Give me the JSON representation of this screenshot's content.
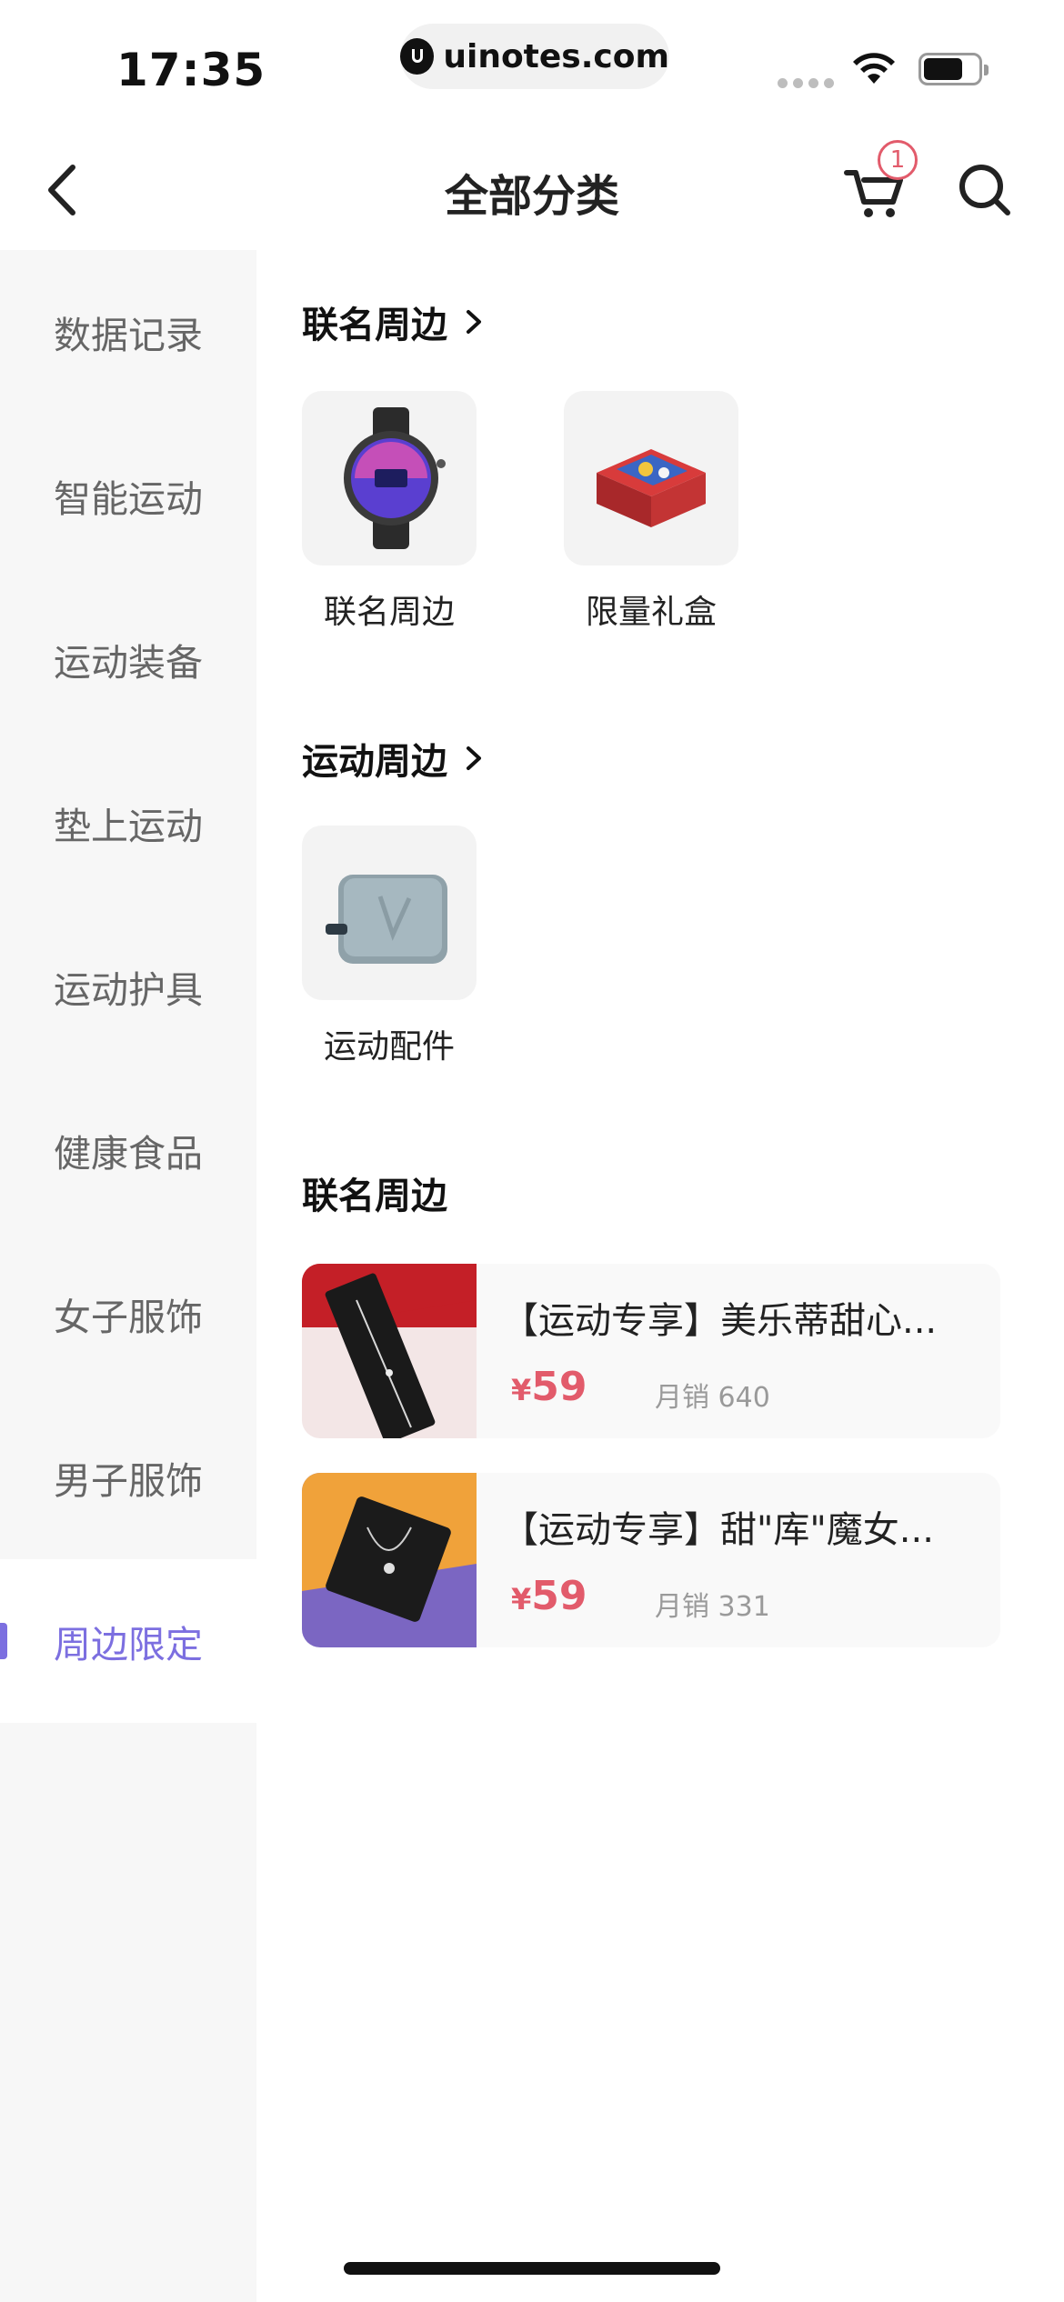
{
  "status_bar": {
    "time": "17:35",
    "url": "uinotes.com"
  },
  "nav": {
    "title": "全部分类",
    "cart_badge": "1"
  },
  "sidebar": {
    "items": [
      {
        "label": "数据记录"
      },
      {
        "label": "智能运动"
      },
      {
        "label": "运动装备"
      },
      {
        "label": "垫上运动"
      },
      {
        "label": "运动护具"
      },
      {
        "label": "健康食品"
      },
      {
        "label": "女子服饰"
      },
      {
        "label": "男子服饰"
      },
      {
        "label": "周边限定"
      }
    ],
    "active_label": "周边限定"
  },
  "sections": [
    {
      "title": "联名周边",
      "tiles": [
        {
          "label": "联名周边"
        },
        {
          "label": "限量礼盒"
        }
      ]
    },
    {
      "title": "运动周边",
      "tiles": [
        {
          "label": "运动配件"
        }
      ]
    }
  ],
  "products_section": {
    "title": "联名周边",
    "items": [
      {
        "title": "【运动专享】美乐蒂甜心...",
        "currency": "¥",
        "price": "59",
        "sales": "月销 640"
      },
      {
        "title": "【运动专享】甜\"库\"魔女...",
        "currency": "¥",
        "price": "59",
        "sales": "月销 331"
      }
    ]
  },
  "colors": {
    "accent": "#7c6fe0",
    "price": "#e25b6b",
    "sidebar_bg": "#f7f7f7"
  }
}
